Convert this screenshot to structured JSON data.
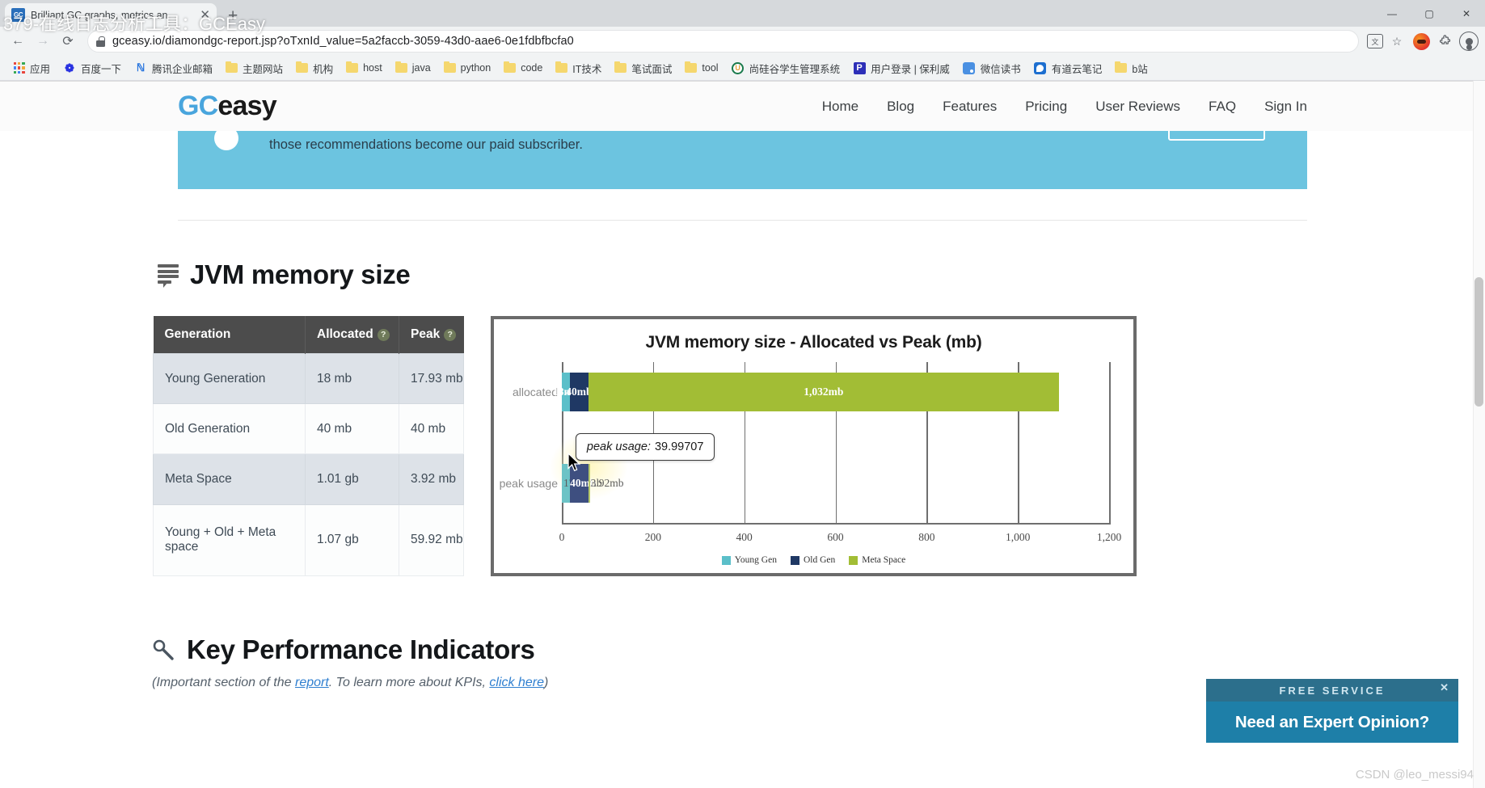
{
  "browser": {
    "tab": {
      "title": "Brilliant GC graphs, metrics an",
      "favicon_label": "GC",
      "close_label": "✕"
    },
    "new_tab_label": "+",
    "window_controls": {
      "minimize": "—",
      "maximize": "▢",
      "close": "✕"
    },
    "nav": {
      "back": "←",
      "forward": "→",
      "reload": "⟳"
    },
    "url": "gceasy.io/diamondgc-report.jsp?oTxnId_value=5a2faccb-3059-43d0-aae6-0e1fdbfbcfa0",
    "toolbar_icons": {
      "translate": "文",
      "bookmark_star": "☆",
      "extension_puzzle": "🧩"
    },
    "bookmarks": [
      {
        "label": "应用",
        "icon": "apps-grid-icon"
      },
      {
        "label": "百度一下",
        "icon": "baidu-icon"
      },
      {
        "label": "腾讯企业邮箱",
        "icon": "tencent-mail-icon"
      },
      {
        "label": "主题网站",
        "icon": "folder-icon"
      },
      {
        "label": "机构",
        "icon": "folder-icon"
      },
      {
        "label": "host",
        "icon": "folder-icon"
      },
      {
        "label": "java",
        "icon": "folder-icon"
      },
      {
        "label": "python",
        "icon": "folder-icon"
      },
      {
        "label": "code",
        "icon": "folder-icon"
      },
      {
        "label": "IT技术",
        "icon": "folder-icon"
      },
      {
        "label": "笔试面试",
        "icon": "folder-icon"
      },
      {
        "label": "tool",
        "icon": "folder-icon"
      },
      {
        "label": "尚硅谷学生管理系统",
        "icon": "circle-u-icon"
      },
      {
        "label": "用户登录 | 保利威",
        "icon": "p-square-icon"
      },
      {
        "label": "微信读书",
        "icon": "wechat-read-icon"
      },
      {
        "label": "有道云笔记",
        "icon": "youdao-note-icon"
      },
      {
        "label": "b站",
        "icon": "folder-icon"
      }
    ]
  },
  "overlay_watermark": "379-在线日志分析工具：GCEasy",
  "csdn_watermark": "CSDN @leo_messi94",
  "site": {
    "logo": {
      "part1": "GC",
      "part2": "easy"
    },
    "nav": [
      {
        "label": "Home"
      },
      {
        "label": "Blog"
      },
      {
        "label": "Features"
      },
      {
        "label": "Pricing"
      },
      {
        "label": "User Reviews"
      },
      {
        "label": "FAQ"
      },
      {
        "label": "Sign In"
      }
    ]
  },
  "promo_banner": {
    "text": "those recommendations become our paid subscriber."
  },
  "jvm_memory": {
    "heading": "JVM memory size",
    "table": {
      "columns": [
        {
          "label": "Generation",
          "has_help": false
        },
        {
          "label": "Allocated",
          "has_help": true
        },
        {
          "label": "Peak",
          "has_help": true
        }
      ],
      "help_glyph": "?",
      "rows": [
        {
          "generation": "Young Generation",
          "allocated": "18 mb",
          "peak": "17.93 mb"
        },
        {
          "generation": "Old Generation",
          "allocated": "40 mb",
          "peak": "40 mb"
        },
        {
          "generation": "Meta Space",
          "allocated": "1.01 gb",
          "peak": "3.92 mb"
        },
        {
          "generation": "Young + Old + Meta space",
          "allocated": "1.07 gb",
          "peak": "59.92 mb"
        }
      ]
    }
  },
  "chart_data": {
    "type": "bar",
    "orientation": "horizontal",
    "stacked": true,
    "title": "JVM memory size - Allocated vs Peak (mb)",
    "categories": [
      "allocated",
      "peak usage"
    ],
    "series": [
      {
        "name": "Young Gen",
        "color": "#5bbfc9",
        "values": [
          18,
          17.93
        ]
      },
      {
        "name": "Old Gen",
        "color": "#1f3864",
        "values": [
          40,
          40
        ]
      },
      {
        "name": "Meta Space",
        "color": "#a2bd35",
        "values": [
          1032,
          3.92
        ]
      }
    ],
    "point_labels": {
      "allocated": [
        "18mb",
        "40mb",
        "1,032mb"
      ],
      "peak_usage": [
        "17.93mb",
        "40mb",
        "3.92mb"
      ]
    },
    "xlabel": "",
    "ylabel": "",
    "xlim": [
      0,
      1200
    ],
    "xticks": [
      0,
      200,
      400,
      600,
      800,
      1000,
      1200
    ],
    "xtick_labels": [
      "0",
      "200",
      "400",
      "600",
      "800",
      "1,000",
      "1,200"
    ],
    "grid": true,
    "legend_position": "bottom",
    "legend": [
      "Young Gen",
      "Old Gen",
      "Meta Space"
    ]
  },
  "tooltip": {
    "label": "peak usage:",
    "value": "39.99707"
  },
  "kpi": {
    "heading": "Key Performance Indicators",
    "subtext_a": "(Important section of the ",
    "subtext_link1": "report",
    "subtext_b": ". To learn more about KPIs, ",
    "subtext_link2": "click here",
    "subtext_c": ")"
  },
  "expert_widget": {
    "banner": "FREE SERVICE",
    "cta": "Need an Expert Opinion?",
    "close": "✕"
  }
}
